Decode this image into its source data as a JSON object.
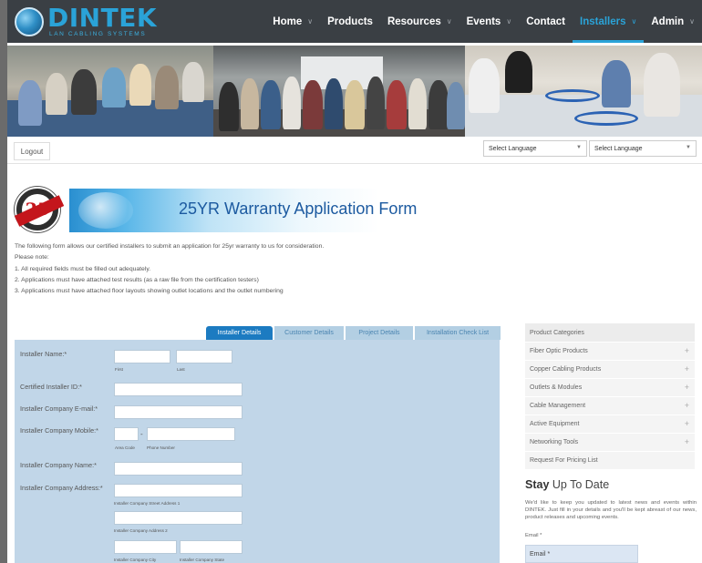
{
  "header": {
    "logo_name": "DINTEK",
    "logo_tagline": "LAN CABLING SYSTEMS",
    "nav": [
      {
        "label": "Home",
        "chevron": true
      },
      {
        "label": "Products",
        "chevron": false
      },
      {
        "label": "Resources",
        "chevron": true
      },
      {
        "label": "Events",
        "chevron": true
      },
      {
        "label": "Contact",
        "chevron": false
      },
      {
        "label": "Installers",
        "chevron": true,
        "active": true
      },
      {
        "label": "Admin",
        "chevron": true
      }
    ],
    "accent_color": "#2aa3d8"
  },
  "toolbar": {
    "logout_label": "Logout",
    "language_select_1": "Select Language",
    "language_select_2": "Select Language"
  },
  "warranty": {
    "seal_number": "25",
    "title": "25YR Warranty Application Form"
  },
  "intro": {
    "lines": [
      "The following form allows our certified installers to submit an application for 25yr warranty to us for consideration.",
      "Please note:",
      "1. All required fields must be filled out adequately.",
      "2. Applications must have attached test results (as a raw file from the certification testers)",
      "3. Applications must have attached floor layouts showing outlet locations and the outlet numbering"
    ]
  },
  "form": {
    "tabs": [
      {
        "label": "Installer Details",
        "active": true
      },
      {
        "label": "Customer Details",
        "active": false
      },
      {
        "label": "Project Details",
        "active": false
      },
      {
        "label": "Installation Check List",
        "active": false
      }
    ],
    "labels": {
      "installer_name": "Installer Name:*",
      "certified_id": "Certified Installer ID:*",
      "company_email": "Installer Company E-mail:*",
      "company_mobile": "Installer Company Mobile:*",
      "company_name": "Installer Company Name:*",
      "company_address": "Installer Company Address:*"
    },
    "hints": {
      "first": "First",
      "last": "Last",
      "area_code": "Area Code",
      "phone_number": "Phone Number",
      "street_address_1": "Installer Company Street Address 1",
      "street_address_2": "Installer Company Address 2",
      "city": "Installer Company City",
      "state": "Installer Company State"
    },
    "dash": "-"
  },
  "sidebar": {
    "header": "Product Categories",
    "categories": [
      {
        "label": "Fiber Optic Products",
        "expandable": true
      },
      {
        "label": "Copper Cabling Products",
        "expandable": true
      },
      {
        "label": "Outlets & Modules",
        "expandable": true
      },
      {
        "label": "Cable Management",
        "expandable": true
      },
      {
        "label": "Active Equipment",
        "expandable": true
      },
      {
        "label": "Networking Tools",
        "expandable": true
      },
      {
        "label": "Request For Pricing List",
        "expandable": false
      }
    ],
    "plus_symbol": "+"
  },
  "newsletter": {
    "title_bold": "Stay",
    "title_rest": " Up To Date",
    "text": "We'd like to keep you updated to latest news and events within DINTEK. Just fill in your details and you'll be kept abreast of our news, product releases and upcoming events.",
    "email_label": "Email *",
    "email_placeholder": "Email *"
  }
}
